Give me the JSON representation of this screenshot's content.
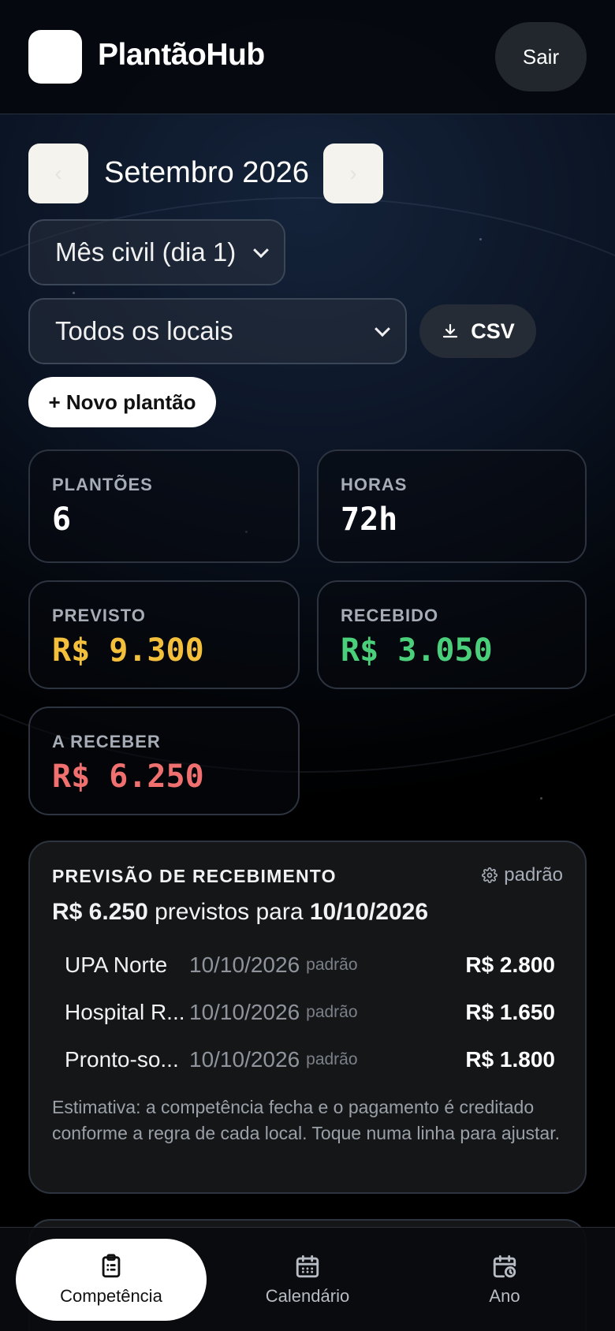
{
  "app": {
    "brand": "PlantãoHub",
    "logout_label": "Sair"
  },
  "period": {
    "prev_icon": "chevron-left-icon",
    "next_icon": "chevron-right-icon",
    "prev_glyph": "‹",
    "next_glyph": "›",
    "month_label": "Setembro 2026"
  },
  "filters": {
    "cycle_value": "Mês civil (dia 1)",
    "location_value": "Todos os locais",
    "csv_label": "CSV"
  },
  "actions": {
    "new_shift_label": "+ Novo plantão"
  },
  "stats": {
    "plantoes": {
      "label": "PLANTÕES",
      "value": "6"
    },
    "horas": {
      "label": "HORAS",
      "value": "72h"
    },
    "previsto": {
      "label": "PREVISTO",
      "value": "R$ 9.300",
      "color": "#f4bf3a"
    },
    "recebido": {
      "label": "RECEBIDO",
      "value": "R$ 3.050",
      "color": "#4ad07a"
    },
    "a_receber": {
      "label": "A RECEBER",
      "value": "R$ 6.250",
      "color": "#f07070"
    }
  },
  "forecast": {
    "title": "PREVISÃO DE RECEBIMENTO",
    "settings_label": "padrão",
    "summary_amount": "R$ 6.250",
    "summary_text": " previstos para ",
    "summary_date": "10/10/2026",
    "rows": [
      {
        "place": "UPA Norte",
        "date": "10/10/2026",
        "tag": "padrão",
        "amount": "R$ 2.800"
      },
      {
        "place": "Hospital R...",
        "date": "10/10/2026",
        "tag": "padrão",
        "amount": "R$ 1.650"
      },
      {
        "place": "Pronto-so...",
        "date": "10/10/2026",
        "tag": "padrão",
        "amount": "R$ 1.800"
      }
    ],
    "note": "Estimativa: a competência fecha e o pagamento é creditado conforme a regra de cada local. Toque numa linha para ajustar."
  },
  "bottom_nav": [
    {
      "label": "Competência",
      "icon": "clipboard-icon",
      "active": true
    },
    {
      "label": "Calendário",
      "icon": "calendar-icon",
      "active": false
    },
    {
      "label": "Ano",
      "icon": "calendar-clock-icon",
      "active": false
    }
  ]
}
